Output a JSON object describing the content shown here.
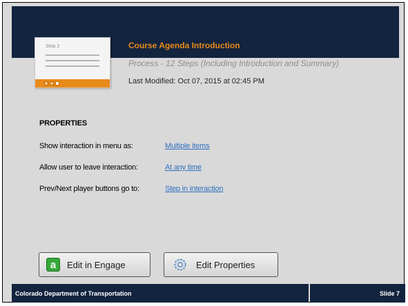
{
  "course": {
    "thumbnail_label": "Step 2",
    "thumbnail_numbers": [
      "1",
      "2",
      "3"
    ],
    "title": "Course Agenda Introduction",
    "subtitle": "Process - 12 Steps (Including Introduction and Summary)",
    "last_modified": "Last Modified: Oct 07, 2015 at 02:45 PM"
  },
  "properties": {
    "heading": "PROPERTIES",
    "rows": [
      {
        "label": "Show interaction in menu as:",
        "value": "Multiple items"
      },
      {
        "label": "Allow user to leave interaction:",
        "value": "At any time"
      },
      {
        "label": "Prev/Next player buttons go to:",
        "value": "Step in interaction"
      }
    ]
  },
  "buttons": {
    "edit_engage": "Edit in Engage",
    "engage_icon_glyph": "a",
    "edit_properties": "Edit Properties"
  },
  "footer": {
    "organization": "Colorado Department of Transportation",
    "slide": "Slide 7"
  },
  "colors": {
    "navy": "#13243f",
    "accent_orange": "#e88a1a",
    "link_blue": "#2f6fc0",
    "panel_gray": "#d9d9d9"
  },
  "icons": {
    "engage": "engage-icon",
    "properties": "gear-icon"
  }
}
